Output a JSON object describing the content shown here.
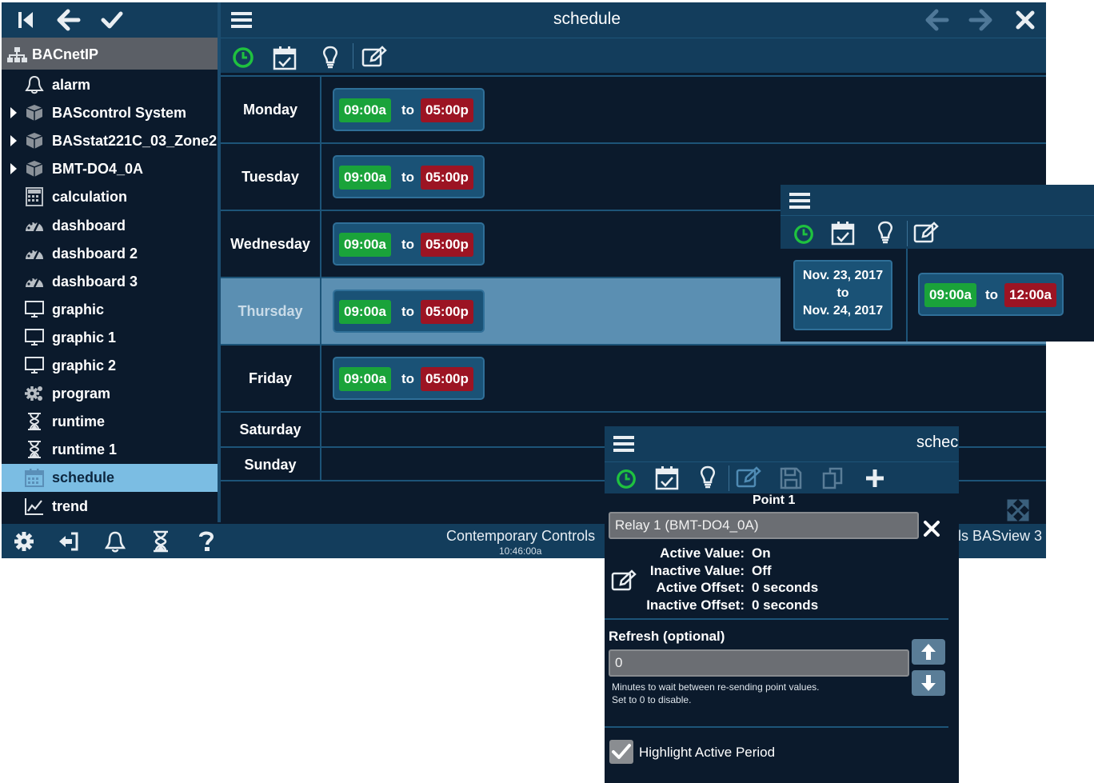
{
  "sidebar": {
    "root_label": "BACnetIP",
    "items": [
      {
        "label": "alarm",
        "icon": "bell-icon",
        "expandable": false
      },
      {
        "label": "BAScontrol System",
        "icon": "cube-icon",
        "expandable": true
      },
      {
        "label": "BASstat221C_03_Zone2",
        "icon": "cube-icon",
        "expandable": true
      },
      {
        "label": "BMT-DO4_0A",
        "icon": "cube-icon",
        "expandable": true
      },
      {
        "label": "calculation",
        "icon": "calculator-icon",
        "expandable": false
      },
      {
        "label": "dashboard",
        "icon": "gauge-icon",
        "expandable": false
      },
      {
        "label": "dashboard 2",
        "icon": "gauge-icon",
        "expandable": false
      },
      {
        "label": "dashboard 3",
        "icon": "gauge-icon",
        "expandable": false
      },
      {
        "label": "graphic",
        "icon": "monitor-icon",
        "expandable": false
      },
      {
        "label": "graphic 1",
        "icon": "monitor-icon",
        "expandable": false
      },
      {
        "label": "graphic 2",
        "icon": "monitor-icon",
        "expandable": false
      },
      {
        "label": "program",
        "icon": "gears-icon",
        "expandable": false
      },
      {
        "label": "runtime",
        "icon": "hourglass-icon",
        "expandable": false
      },
      {
        "label": "runtime 1",
        "icon": "hourglass-icon",
        "expandable": false
      },
      {
        "label": "schedule",
        "icon": "calendar-icon",
        "expandable": false,
        "selected": true
      },
      {
        "label": "trend",
        "icon": "trend-icon",
        "expandable": false
      }
    ]
  },
  "header": {
    "title": "schedule"
  },
  "schedule": {
    "rows": [
      {
        "day": "Monday",
        "start": "09:00a",
        "sep": "to",
        "end": "05:00p"
      },
      {
        "day": "Tuesday",
        "start": "09:00a",
        "sep": "to",
        "end": "05:00p"
      },
      {
        "day": "Wednesday",
        "start": "09:00a",
        "sep": "to",
        "end": "05:00p"
      },
      {
        "day": "Thursday",
        "start": "09:00a",
        "sep": "to",
        "end": "05:00p",
        "highlighted": true
      },
      {
        "day": "Friday",
        "start": "09:00a",
        "sep": "to",
        "end": "05:00p"
      },
      {
        "day": "Saturday"
      },
      {
        "day": "Sunday"
      }
    ]
  },
  "status": {
    "brand": "Contemporary Controls",
    "time": "10:46:00a",
    "product": "ls BASview 3"
  },
  "exception": {
    "date_start": "Nov. 23, 2017",
    "date_to": "to",
    "date_end": "Nov. 24, 2017",
    "start": "09:00a",
    "sep": "to",
    "end": "12:00a"
  },
  "point_dialog": {
    "title": "schec",
    "section": "Point 1",
    "point_value": "Relay 1 (BMT-DO4_0A)",
    "props": [
      {
        "label": "Active Value:",
        "value": "On"
      },
      {
        "label": "Inactive Value:",
        "value": "Off"
      },
      {
        "label": "Active Offset:",
        "value": "0 seconds"
      },
      {
        "label": "Inactive Offset:",
        "value": "0 seconds"
      }
    ],
    "refresh_label": "Refresh (optional)",
    "refresh_value": "0",
    "help_line1": "Minutes to wait between re-sending point values.",
    "help_line2": "Set to 0 to disable.",
    "highlight_label": "Highlight Active Period",
    "highlight_checked": true
  },
  "colors": {
    "panel": "#133d5c",
    "background": "#0b1a2c",
    "start_tag": "#1aa33a",
    "end_tag": "#9c1423",
    "selected": "#7bbde3"
  }
}
